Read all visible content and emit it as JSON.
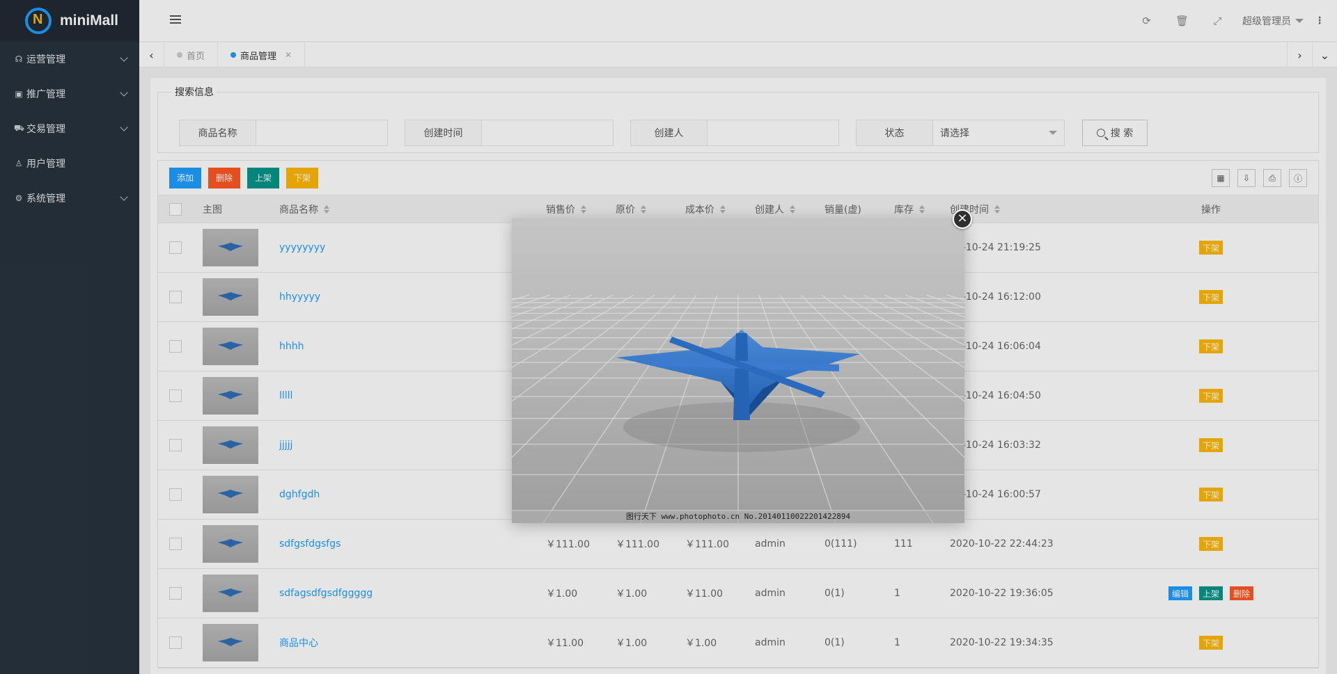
{
  "app": {
    "logo_text": "miniMall"
  },
  "sidebar": {
    "items": [
      {
        "label": "运营管理",
        "icon": "headset-icon"
      },
      {
        "label": "推广管理",
        "icon": "gift-icon"
      },
      {
        "label": "交易管理",
        "icon": "cart-icon"
      },
      {
        "label": "用户管理",
        "icon": "user-icon"
      },
      {
        "label": "系统管理",
        "icon": "gear-icon"
      }
    ]
  },
  "header": {
    "user_name": "超级管理员"
  },
  "tabs": [
    {
      "label": "首页"
    },
    {
      "label": "商品管理"
    }
  ],
  "search": {
    "legend": "搜索信息",
    "fields": [
      {
        "label": "商品名称",
        "value": ""
      },
      {
        "label": "创建时间",
        "value": ""
      },
      {
        "label": "创建人",
        "value": ""
      }
    ],
    "status_label": "状态",
    "status_value": "请选择",
    "button_label": "搜 索"
  },
  "toolbar": {
    "add": "添加",
    "delete": "删除",
    "on_shelf": "上架",
    "off_shelf": "下架"
  },
  "table": {
    "headers": {
      "image": "主图",
      "name": "商品名称",
      "sale_price": "销售价",
      "orig_price": "原价",
      "cost_price": "成本价",
      "creator": "创建人",
      "sold": "销量(虚)",
      "stock": "库存",
      "created": "创建时间",
      "ops": "操作"
    },
    "rows": [
      {
        "name": "yyyyyyyy",
        "sale": "",
        "orig": "",
        "cost": "",
        "creator": "",
        "sold": "",
        "stock": "",
        "time": "20-10-24 21:19:25",
        "ops": [
          "下架"
        ]
      },
      {
        "name": "hhyyyyy",
        "sale": "",
        "orig": "",
        "cost": "",
        "creator": "",
        "sold": "",
        "stock": "",
        "time": "20-10-24 16:12:00",
        "ops": [
          "下架"
        ]
      },
      {
        "name": "hhhh",
        "sale": "",
        "orig": "",
        "cost": "",
        "creator": "",
        "sold": "",
        "stock": "",
        "time": "20-10-24 16:06:04",
        "ops": [
          "下架"
        ]
      },
      {
        "name": "lllll",
        "sale": "",
        "orig": "",
        "cost": "",
        "creator": "",
        "sold": "",
        "stock": "",
        "time": "20-10-24 16:04:50",
        "ops": [
          "下架"
        ]
      },
      {
        "name": "jjjjj",
        "sale": "",
        "orig": "",
        "cost": "",
        "creator": "",
        "sold": "",
        "stock": "",
        "time": "20-10-24 16:03:32",
        "ops": [
          "下架"
        ]
      },
      {
        "name": "dghfgdh",
        "sale": "",
        "orig": "",
        "cost": "",
        "creator": "",
        "sold": "",
        "stock": "",
        "time": "20-10-24 16:00:57",
        "ops": [
          "下架"
        ]
      },
      {
        "name": "sdfgsfdgsfgs",
        "sale": "￥111.00",
        "orig": "￥111.00",
        "cost": "￥111.00",
        "creator": "admin",
        "sold": "0(111)",
        "stock": "111",
        "time": "2020-10-22 22:44:23",
        "ops": [
          "下架"
        ]
      },
      {
        "name": "sdfagsdfgsdfggggg",
        "sale": "￥1.00",
        "orig": "￥1.00",
        "cost": "￥11.00",
        "creator": "admin",
        "sold": "0(1)",
        "stock": "1",
        "time": "2020-10-22 19:36:05",
        "ops": [
          "编辑",
          "上架",
          "删除"
        ]
      },
      {
        "name": "商品中心",
        "sale": "￥11.00",
        "orig": "￥1.00",
        "cost": "￥1.00",
        "creator": "admin",
        "sold": "0(1)",
        "stock": "1",
        "time": "2020-10-22 19:34:35",
        "ops": [
          "下架"
        ]
      }
    ]
  },
  "modal": {
    "caption": "图行天下 www.photophoto.cn  No.20140110022201422894",
    "close_symbol": "×"
  },
  "colors": {
    "sidebar_bg": "#28333e",
    "primary": "#1e9fff",
    "danger": "#ff5722",
    "success": "#009688",
    "warn": "#ffb800"
  }
}
